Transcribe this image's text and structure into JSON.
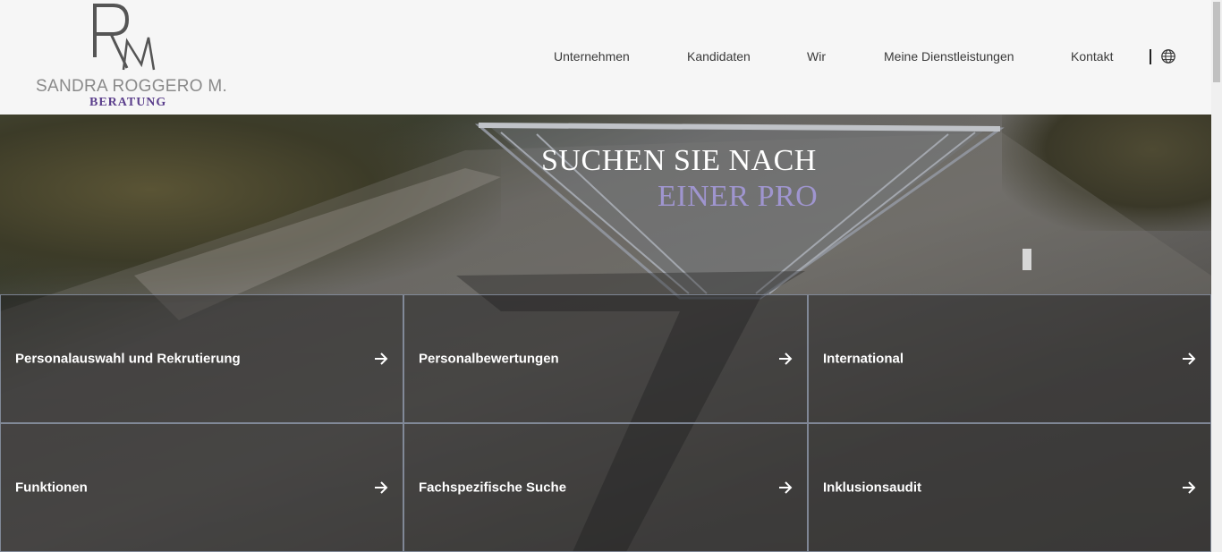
{
  "header": {
    "logo": {
      "monogram": "RM",
      "name": "SANDRA ROGGERO M.",
      "subtitle": "BERATUNG"
    },
    "nav": [
      {
        "label": "Unternehmen"
      },
      {
        "label": "Kandidaten"
      },
      {
        "label": "Wir"
      },
      {
        "label": "Meine Dienstleistungen"
      },
      {
        "label": "Kontakt"
      }
    ],
    "language_icon": "globe-icon"
  },
  "hero": {
    "title": "SUCHEN SIE NACH",
    "subtitle": "EINER PRO",
    "title_color": "#ffffff",
    "subtitle_color": "#9f95cf"
  },
  "tiles": [
    {
      "label": "Personalauswahl und Rekrutierung",
      "icon": "arrow-right-icon"
    },
    {
      "label": "Personalbewertungen",
      "icon": "arrow-right-icon"
    },
    {
      "label": "International",
      "icon": "arrow-right-icon"
    },
    {
      "label": "Funktionen",
      "icon": "arrow-right-icon"
    },
    {
      "label": "Fachspezifische Suche",
      "icon": "arrow-right-icon"
    },
    {
      "label": "Inklusionsaudit",
      "icon": "arrow-right-icon"
    }
  ],
  "colors": {
    "accent_purple": "#5b3f8c",
    "tile_border": "#96a0b4"
  }
}
